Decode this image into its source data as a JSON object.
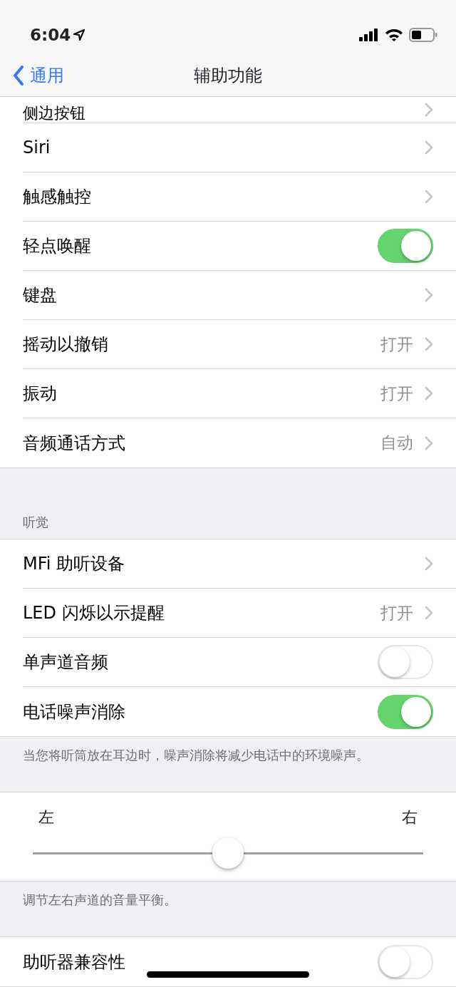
{
  "status_bar": {
    "time": "6:04"
  },
  "nav": {
    "back": "通用",
    "title": "辅助功能"
  },
  "sections": [
    {
      "rows": [
        {
          "kind": "link",
          "label": "侧边按钮",
          "cut": true
        },
        {
          "kind": "link",
          "label": "Siri"
        },
        {
          "kind": "link",
          "label": "触感触控"
        },
        {
          "kind": "toggle",
          "label": "轻点唤醒",
          "on": true
        },
        {
          "kind": "link",
          "label": "键盘"
        },
        {
          "kind": "link",
          "label": "摇动以撤销",
          "value": "打开"
        },
        {
          "kind": "link",
          "label": "振动",
          "value": "打开"
        },
        {
          "kind": "link",
          "label": "音频通话方式",
          "value": "自动"
        }
      ]
    },
    {
      "header": "听觉",
      "rows": [
        {
          "kind": "link",
          "label": "MFi 助听设备"
        },
        {
          "kind": "link",
          "label": "LED 闪烁以示提醒",
          "value": "打开"
        },
        {
          "kind": "toggle",
          "label": "单声道音频",
          "on": false
        },
        {
          "kind": "toggle",
          "label": "电话噪声消除",
          "on": true
        }
      ],
      "footer": "当您将听筒放在耳边时，噪声消除将减少电话中的环境噪声。"
    },
    {
      "rows": [
        {
          "kind": "slider",
          "left": "左",
          "right": "右",
          "level": 0.5
        }
      ],
      "footer": "调节左右声道的音量平衡。"
    },
    {
      "rows": [
        {
          "kind": "toggle",
          "label": "助听器兼容性",
          "on": false
        }
      ]
    }
  ]
}
